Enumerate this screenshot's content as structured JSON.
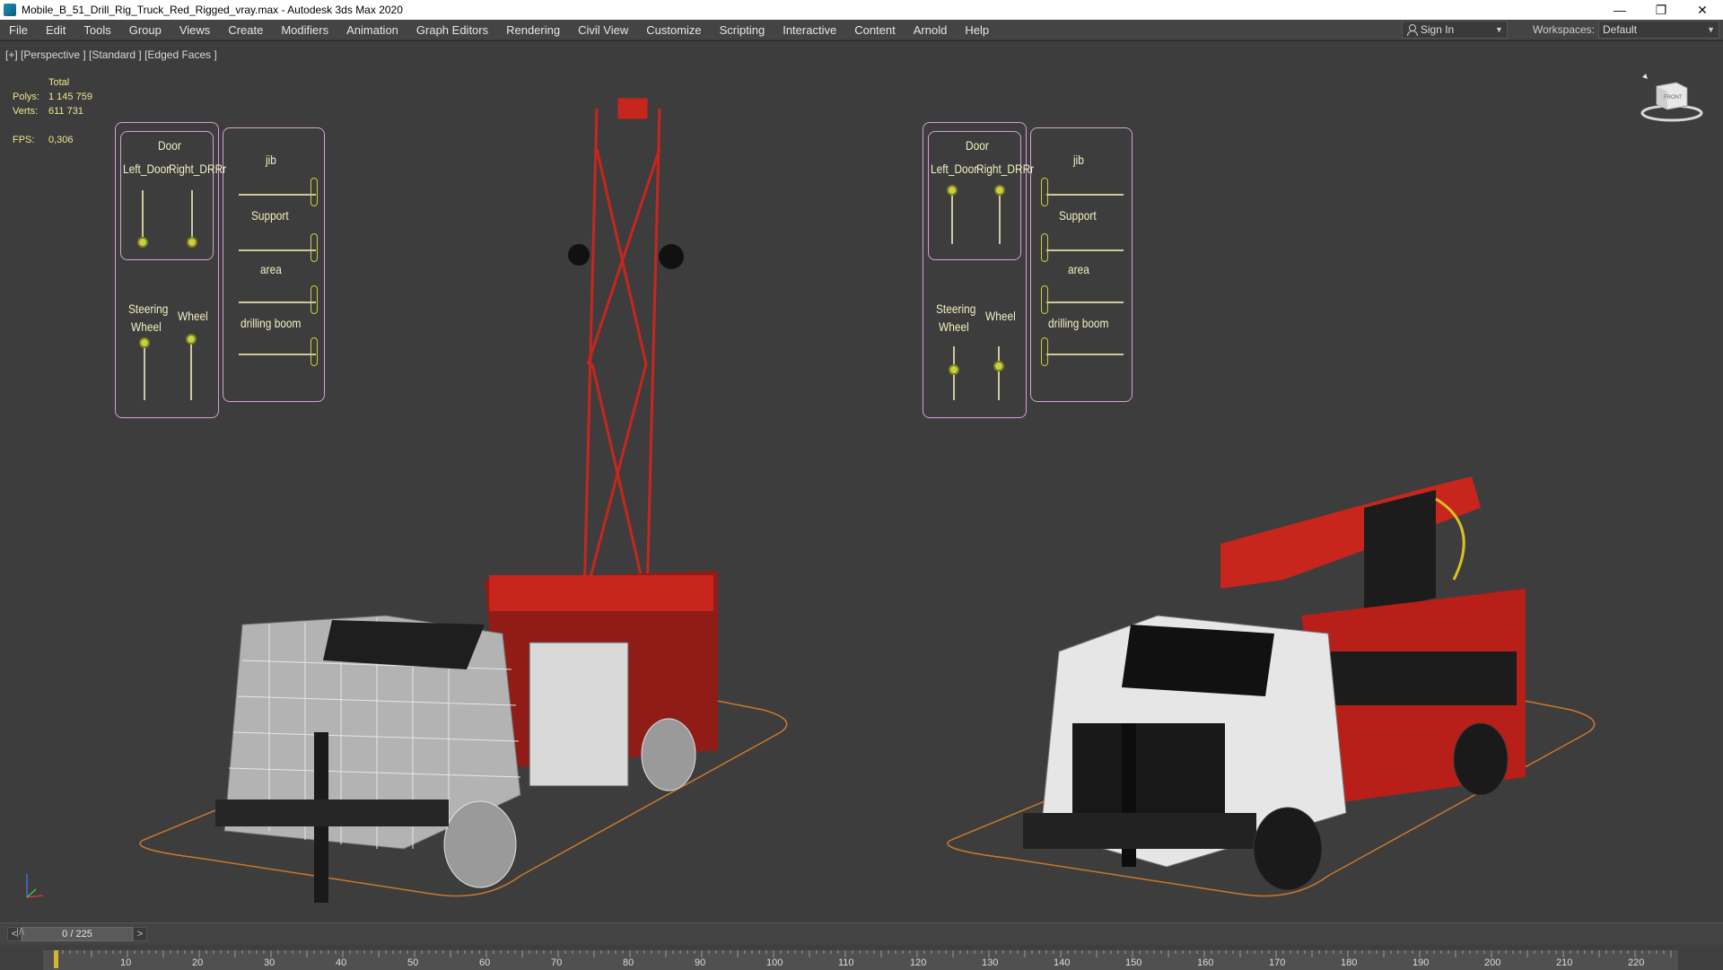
{
  "window": {
    "title": "Mobile_B_51_Drill_Rig_Truck_Red_Rigged_vray.max - Autodesk 3ds Max 2020"
  },
  "menu": [
    "File",
    "Edit",
    "Tools",
    "Group",
    "Views",
    "Create",
    "Modifiers",
    "Animation",
    "Graph Editors",
    "Rendering",
    "Civil View",
    "Customize",
    "Scripting",
    "Interactive",
    "Content",
    "Arnold",
    "Help"
  ],
  "signin": {
    "label": "Sign In"
  },
  "workspaces": {
    "label": "Workspaces:",
    "value": "Default"
  },
  "viewport": {
    "label": "[+] [Perspective ] [Standard ] [Edged Faces ]",
    "stats": {
      "header": "Total",
      "polys_label": "Polys:",
      "polys": "1 145 759",
      "verts_label": "Verts:",
      "verts": "611 731",
      "fps_label": "FPS:",
      "fps": "0,306"
    }
  },
  "control_panels": [
    {
      "door": "Door",
      "left_door": "Left_Door",
      "right_door": "Right_DRRr",
      "steering": "Steering",
      "steering2": "Wheel",
      "wheel": "Wheel",
      "jib": "jib",
      "support": "Support",
      "area": "area",
      "drilling_boom": "drilling boom"
    },
    {
      "door": "Door",
      "left_door": "Left_Door",
      "right_door": "Right_DRRr",
      "steering": "Steering",
      "steering2": "Wheel",
      "wheel": "Wheel",
      "jib": "jib",
      "support": "Support",
      "area": "area",
      "drilling_boom": "drilling boom"
    }
  ],
  "timeline": {
    "frame": "0 / 225",
    "prev": "<",
    "next": ">",
    "ticks": [
      "10",
      "20",
      "30",
      "40",
      "50",
      "60",
      "70",
      "80",
      "90",
      "100",
      "110",
      "120",
      "130",
      "140",
      "150",
      "160",
      "170",
      "180",
      "190",
      "200",
      "210",
      "220"
    ]
  },
  "colors": {
    "accent_red": "#c8261d",
    "wire_gray": "#bfbfbf",
    "panel_outline": "#d7a0d7",
    "stats_yellow": "#f0e68c"
  }
}
